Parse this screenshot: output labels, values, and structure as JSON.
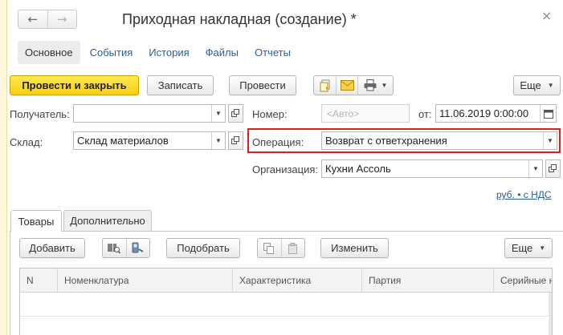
{
  "window": {
    "title": "Приходная накладная (создание) *",
    "back_icon": "←",
    "forward_icon": "→",
    "close_icon": "×"
  },
  "nav_links": {
    "main": "Основное",
    "events": "События",
    "history": "История",
    "files": "Файлы",
    "reports": "Отчеты"
  },
  "toolbar": {
    "post_close_label": "Провести и закрыть",
    "save_label": "Записать",
    "post_label": "Провести",
    "more_label": "Еще",
    "icons": [
      "document-stack-icon",
      "envelope-icon",
      "printer-icon"
    ]
  },
  "form": {
    "recipient_label": "Получатель:",
    "recipient_value": "",
    "number_label": "Номер:",
    "number_placeholder": "<Авто>",
    "date_label": "от:",
    "date_value": "11.06.2019  0:00:00",
    "warehouse_label": "Склад:",
    "warehouse_value": "Склад материалов",
    "operation_label": "Операция:",
    "operation_value": "Возврат с ответхранения",
    "organization_label": "Организация:",
    "organization_value": "Кухни Ассоль",
    "vat_link": "руб. • с НДС"
  },
  "colors": {
    "accent_yellow": "#f6cf11",
    "link_blue": "#2b5d9a",
    "highlight_red": "#d9201b"
  },
  "tabs": [
    {
      "label": "Товары",
      "active": true
    },
    {
      "label": "Дополнительно",
      "active": false
    }
  ],
  "goods_toolbar": {
    "add_label": "Добавить",
    "pick_label": "Подобрать",
    "change_label": "Изменить",
    "more_label": "Еще"
  },
  "table": {
    "columns": [
      "N",
      "Номенклатура",
      "Характеристика",
      "Партия",
      "Серийные н"
    ],
    "rows": []
  }
}
